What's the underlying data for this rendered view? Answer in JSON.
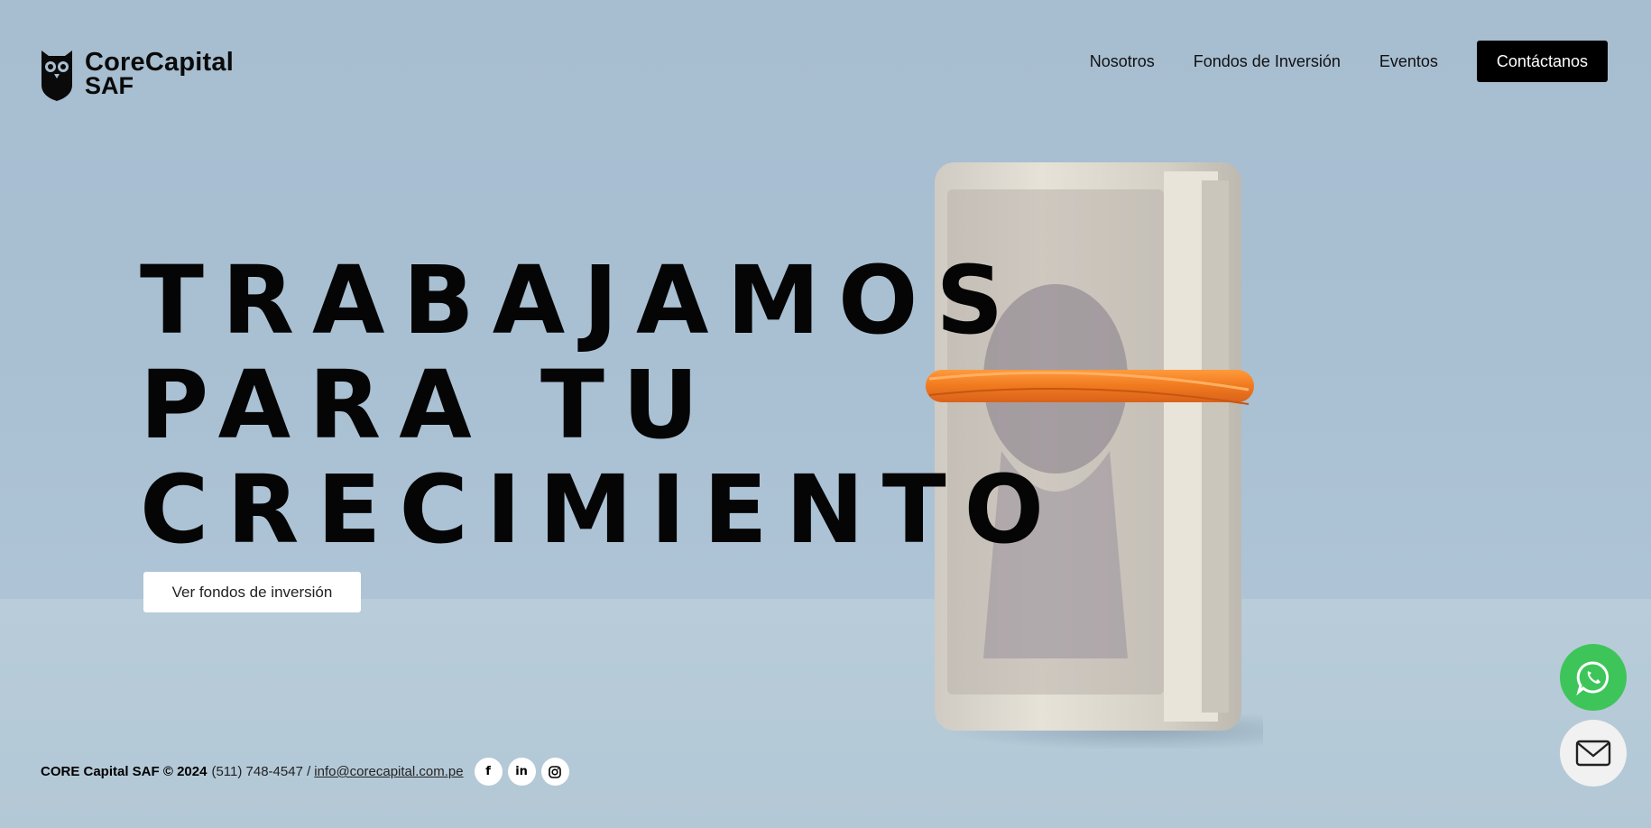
{
  "header": {
    "logo_line1": "CoreCapital",
    "logo_line2": "SAF",
    "nav": [
      "Nosotros",
      "Fondos de Inversión",
      "Eventos"
    ],
    "cta": "Contáctanos"
  },
  "hero": {
    "title_lines": [
      "TRABAJAMOS",
      "PARA TU",
      "CRECIMIENTO"
    ],
    "button": "Ver fondos de inversión"
  },
  "footer": {
    "company": "CORE Capital SAF © 2024",
    "phone": "(511) 748-4547 /",
    "email": "info@corecapital.com.pe",
    "socials": [
      "facebook-icon",
      "linkedin-icon",
      "instagram-icon"
    ]
  },
  "floating": [
    "whatsapp-icon",
    "mail-icon"
  ],
  "colors": {
    "accent": "#000000",
    "whatsapp": "#3EC55A",
    "background": "#A8BFD1"
  }
}
